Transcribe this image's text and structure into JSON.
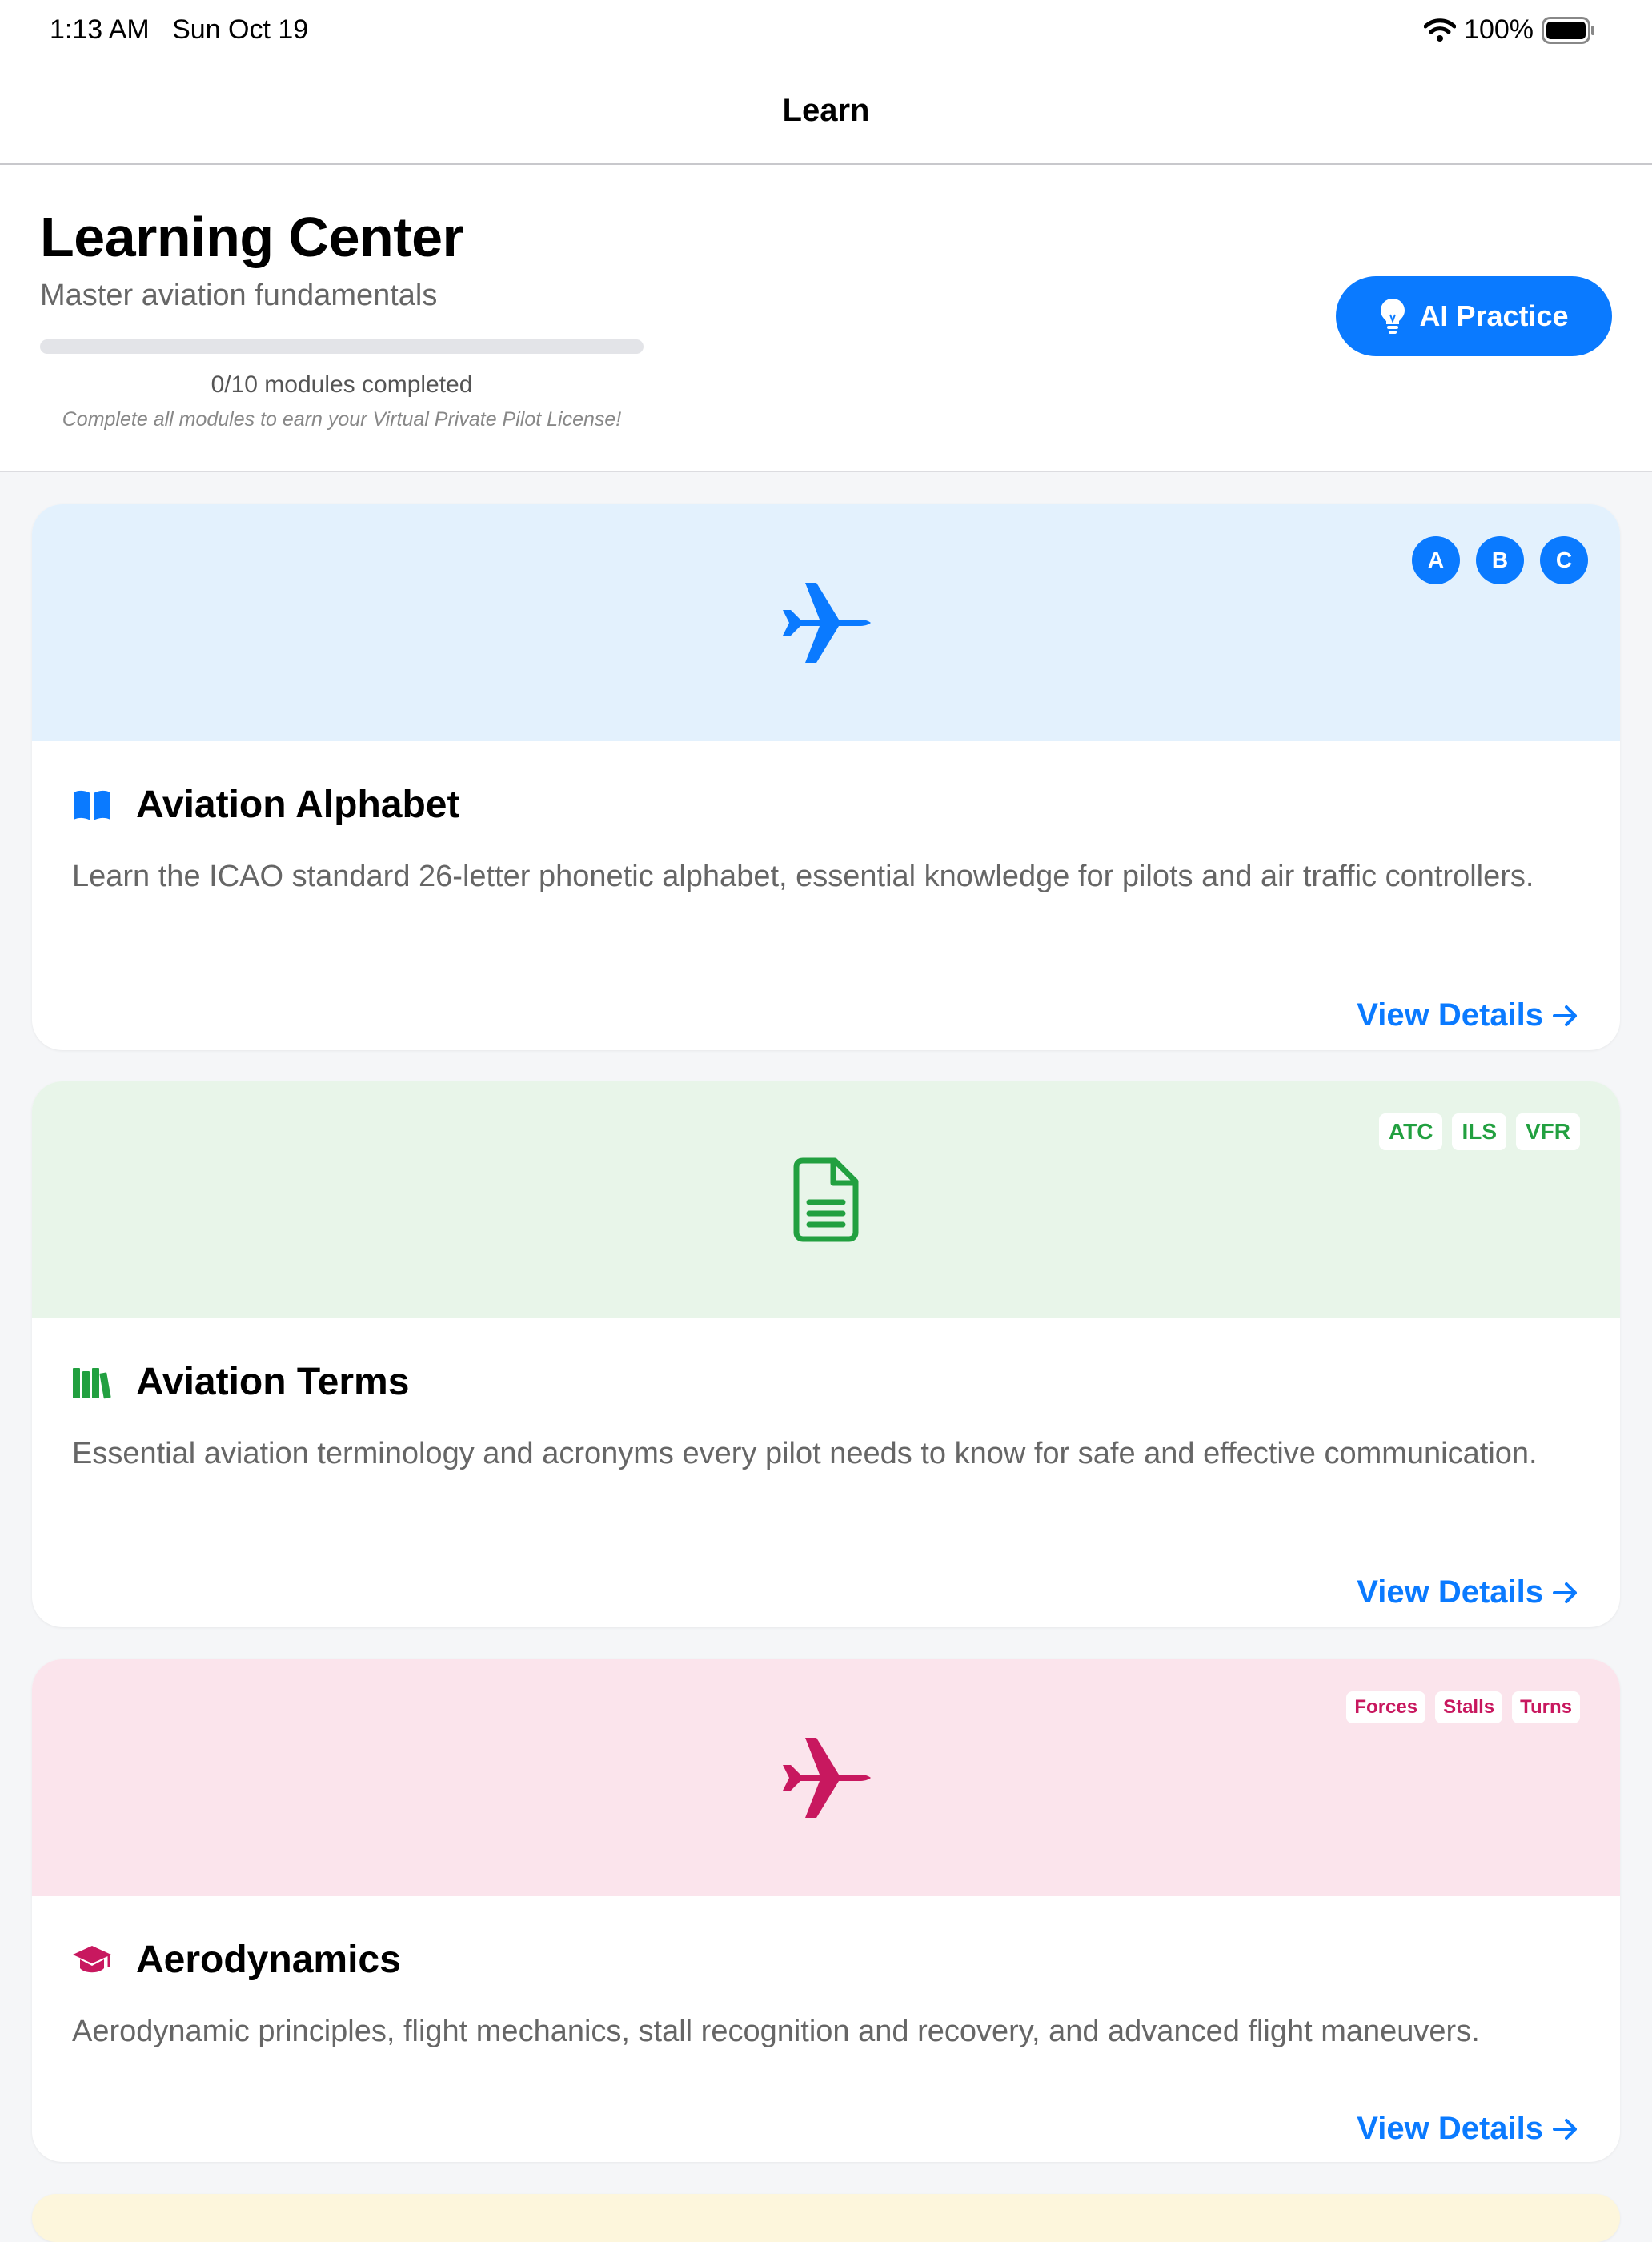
{
  "status_bar": {
    "time": "1:13 AM",
    "date": "Sun Oct 19",
    "battery": "100%"
  },
  "nav": {
    "title": "Learn"
  },
  "header": {
    "title": "Learning Center",
    "subtitle": "Master aviation fundamentals",
    "progress_fraction": 0,
    "progress_text": "0/10 modules completed",
    "note": "Complete all modules to earn your Virtual Private Pilot License!",
    "ai_button": "AI Practice"
  },
  "modules": [
    {
      "title": "Aviation Alphabet",
      "description": "Learn the ICAO standard 26-letter phonetic alphabet, essential knowledge for pilots and air traffic controllers.",
      "badges": [
        "A",
        "B",
        "C"
      ],
      "hero_icon": "airplane-icon",
      "title_icon": "book-icon",
      "hero_color": "#e3f1fd",
      "accent_color": "#0a7aff",
      "link": "View Details"
    },
    {
      "title": "Aviation Terms",
      "description": "Essential aviation terminology and acronyms every pilot needs to know for safe and effective communication.",
      "tags": [
        "ATC",
        "ILS",
        "VFR"
      ],
      "hero_icon": "document-icon",
      "title_icon": "books-icon",
      "hero_color": "#e8f5e9",
      "accent_color": "#22a040",
      "link": "View Details"
    },
    {
      "title": "Aerodynamics",
      "description": "Aerodynamic principles, flight mechanics, stall recognition and recovery, and advanced flight maneuvers.",
      "tags": [
        "Forces",
        "Stalls",
        "Turns"
      ],
      "hero_icon": "airplane-icon",
      "title_icon": "graduation-cap-icon",
      "hero_color": "#fbe4ec",
      "accent_color": "#c8185f",
      "link": "View Details"
    }
  ]
}
